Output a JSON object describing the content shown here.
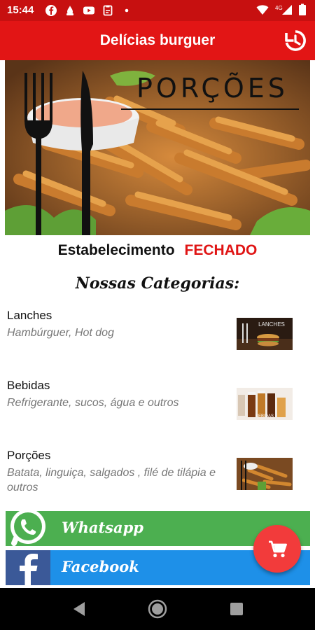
{
  "status_bar": {
    "time": "15:44",
    "left_icons": [
      "facebook-icon",
      "sauce-icon",
      "youtube-icon",
      "clipboard-icon",
      "dot-icon"
    ],
    "right_icons": [
      "wifi-icon",
      "signal-icon",
      "battery-icon"
    ],
    "network": "4G"
  },
  "app_bar": {
    "title": "Delícias burguer",
    "history_icon": "history-icon"
  },
  "banner": {
    "title": "PORÇÕES"
  },
  "establishment": {
    "label": "Estabelecimento",
    "status": "FECHADO",
    "status_color": "#e01414"
  },
  "categories_title": "Nossas Categorias:",
  "categories": [
    {
      "name": "Lanches",
      "description": "Hambúrguer, Hot dog",
      "thumb_label": "LANCHES"
    },
    {
      "name": "Bebidas",
      "description": "Refrigerante, sucos, água e outros",
      "thumb_label": "BEBIDAS"
    },
    {
      "name": "Porções",
      "description": "Batata, linguiça, salgados , filé de tilápia e outros",
      "thumb_label": ""
    }
  ],
  "social": {
    "whatsapp_label": "Whatsapp",
    "whatsapp_color": "#4caf50",
    "facebook_label": "Facebook",
    "facebook_color": "#1e90e8"
  },
  "fab": {
    "icon": "cart-icon",
    "color": "#f23b3b"
  },
  "nav": {
    "back": "back-icon",
    "home": "home-icon",
    "recents": "recents-icon"
  },
  "colors": {
    "primary": "#e21515",
    "primary_dark": "#c71010"
  }
}
